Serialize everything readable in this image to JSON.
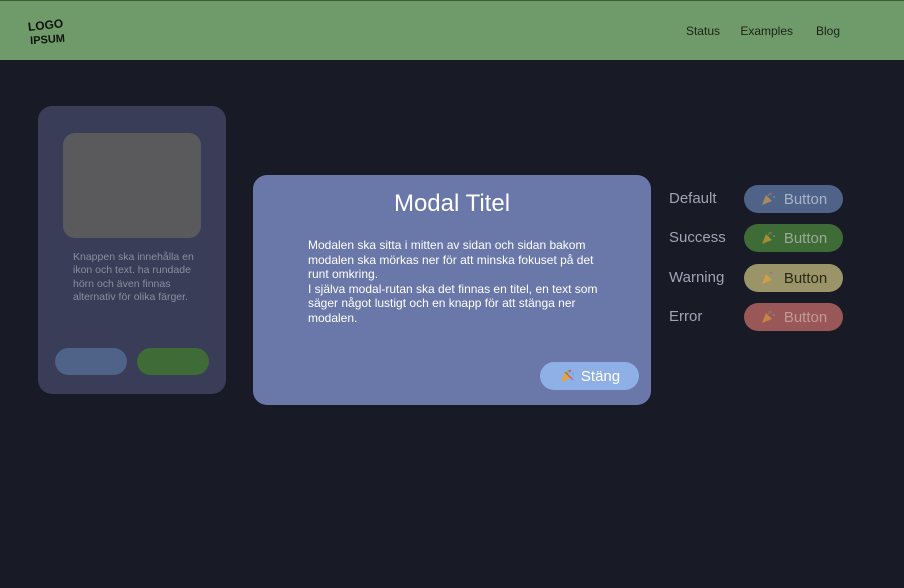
{
  "header": {
    "logo_text": [
      "LOGO",
      "IPSUM"
    ],
    "nav": [
      {
        "label": "Status"
      },
      {
        "label": "Examples"
      },
      {
        "label": "Blog"
      }
    ]
  },
  "card": {
    "text": "Knappen ska innehålla en ikon och text. ha rundade hörn och även finnas alternativ för olika färger."
  },
  "modal": {
    "title": "Modal Titel",
    "paragraph1": "Modalen ska sitta i mitten av sidan och sidan bakom modalen ska mörkas ner för att minska fokuset på det runt omkring.",
    "paragraph2": "I själva modal-rutan ska det finnas en titel, en text som säger något lustigt och en knapp för att stänga ner modalen.",
    "close_label": "Stäng"
  },
  "variants": [
    {
      "label": "Default",
      "button": "Button",
      "color": "#4f6388",
      "text_color": "#a9b3c8"
    },
    {
      "label": "Success",
      "button": "Button",
      "color": "#3e6b36",
      "text_color": "#9aab95"
    },
    {
      "label": "Warning",
      "button": "Button",
      "color": "#9a9468",
      "text_color": "#2a2818"
    },
    {
      "label": "Error",
      "button": "Button",
      "color": "#9a5757",
      "text_color": "#c19a9a"
    }
  ],
  "colors": {
    "background": "#181a26",
    "header": "#6e9b69",
    "modal": "#6a77a9",
    "close_button": "#8fb0e6"
  },
  "icons": {
    "button_icon": "party-popper-icon"
  }
}
